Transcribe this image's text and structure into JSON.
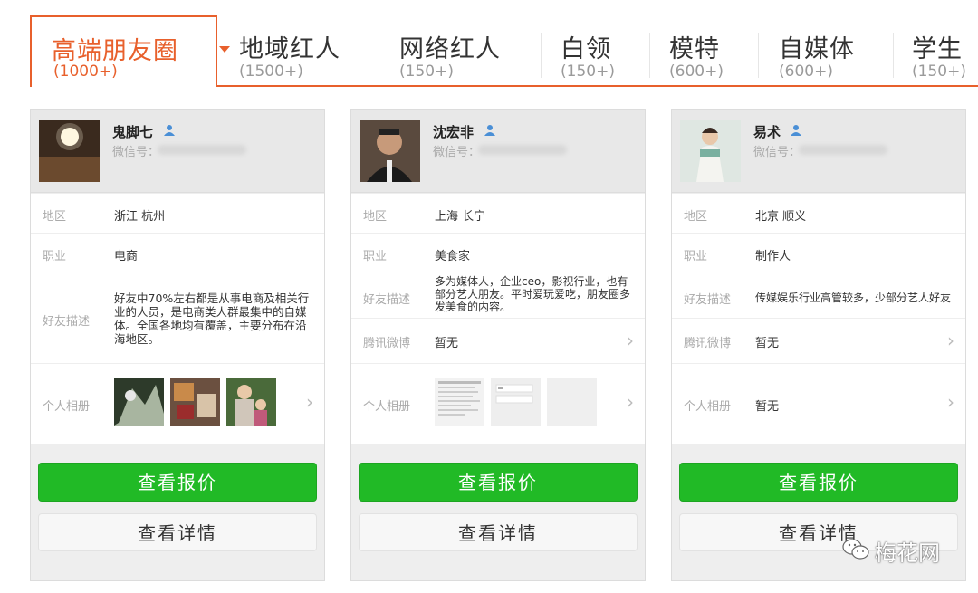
{
  "tabs": [
    {
      "label": "高端朋友圈",
      "count": "(1000+)",
      "active": true
    },
    {
      "label": "地域红人",
      "count": "(1500+)"
    },
    {
      "label": "网络红人",
      "count": "(150+)"
    },
    {
      "label": "白领",
      "count": "(150+)"
    },
    {
      "label": "模特",
      "count": "(600+)"
    },
    {
      "label": "自媒体",
      "count": "(600+)"
    },
    {
      "label": "学生",
      "count": "(150+)"
    }
  ],
  "labels": {
    "wxid": "微信号：",
    "region": "地区",
    "job": "职业",
    "desc": "好友描述",
    "weibo": "腾讯微博",
    "album": "个人相册",
    "btn_quote": "查看报价",
    "btn_detail": "查看详情"
  },
  "cards": [
    {
      "name": "鬼脚七",
      "region": "浙江 杭州",
      "job": "电商",
      "desc": "好友中70%左右都是从事电商及相关行业的人员，是电商类人群最集中的自媒体。全国各地均有覆盖，主要分布在沿海地区。"
    },
    {
      "name": "沈宏非",
      "region": "上海 长宁",
      "job": "美食家",
      "desc": "多为媒体人，企业ceo，影视行业，也有部分艺人朋友。平时爱玩爱吃，朋友圈多发美食的内容。",
      "weibo": "暂无"
    },
    {
      "name": "易术",
      "region": "北京 顺义",
      "job": "制作人",
      "desc": "传媒娱乐行业高管较多，少部分艺人好友",
      "weibo": "暂无",
      "album": "暂无"
    }
  ],
  "watermark": {
    "text": "梅花网"
  },
  "colors": {
    "accent": "#e8602c",
    "primary_button": "#21ba26"
  }
}
